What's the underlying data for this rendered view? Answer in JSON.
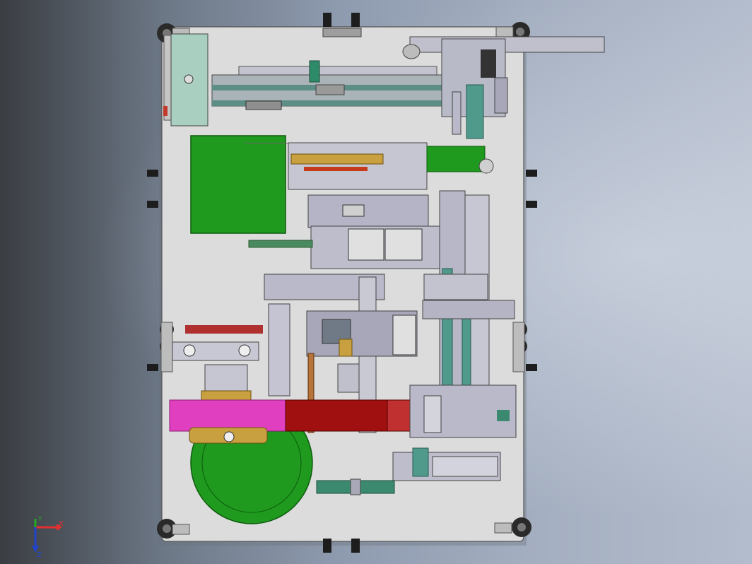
{
  "viewport": {
    "name": "solidworks-graphics-area",
    "background_colors": [
      "#3a3d42",
      "#8e9aae",
      "#b3bccc"
    ]
  },
  "model": {
    "plate_color": "#dcdcdc",
    "colors": {
      "steel": "#a9aab6",
      "green_panel": "#1f9a1f",
      "teal_rail": "#4f9a8a",
      "magenta_ring": "#e040c0",
      "red_belt": "#a01010",
      "blue_gray_part": "#9fa0c0"
    }
  },
  "triad": {
    "x_label": "X",
    "y_label": "Y",
    "z_label": "Z"
  }
}
